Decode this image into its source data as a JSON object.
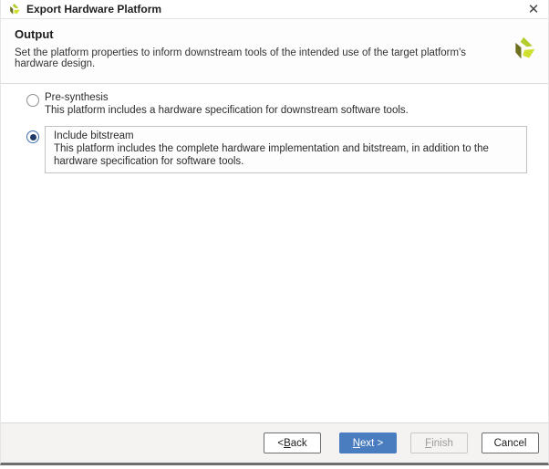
{
  "window": {
    "title": "Export Hardware Platform",
    "close_glyph": "✕"
  },
  "header": {
    "title": "Output",
    "subtitle": "Set the platform properties to inform downstream tools of the intended use of the target platform's hardware design."
  },
  "options": [
    {
      "label": "Pre-synthesis",
      "description": "This platform includes a hardware specification for downstream software tools.",
      "selected": false
    },
    {
      "label": "Include bitstream",
      "description": "This platform includes the complete hardware implementation and bitstream, in addition to the hardware specification for software tools.",
      "selected": true
    }
  ],
  "footer": {
    "back_label": "< Back",
    "back_mnemonic": "B",
    "next_label": "Next >",
    "next_mnemonic": "N",
    "finish_label": "Finish",
    "finish_mnemonic": "F",
    "cancel_label": "Cancel"
  },
  "colors": {
    "accent_blue": "#4a7cc0",
    "radio_selected_dot": "#1f3a66",
    "logo_olive": "#6d701d",
    "logo_yellow_green": "#b5cc2e",
    "logo_lime": "#cfe02e",
    "footer_bg": "#f4f3f2"
  }
}
